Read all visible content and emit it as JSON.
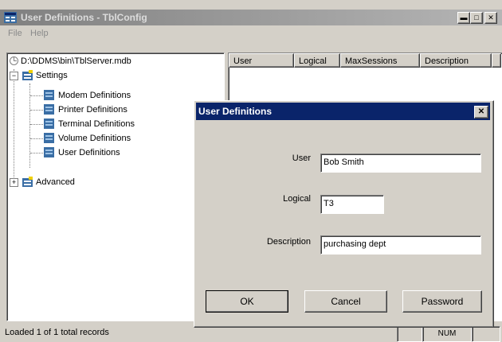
{
  "window": {
    "title": "User Definitions - TblConfig"
  },
  "menu": {
    "items": [
      "File",
      "Help"
    ]
  },
  "tree": {
    "root": "D:\\DDMS\\bin\\TblServer.mdb",
    "settings": "Settings",
    "children": [
      "Modem Definitions",
      "Printer Definitions",
      "Terminal Definitions",
      "Volume Definitions",
      "User Definitions"
    ],
    "advanced": "Advanced"
  },
  "list": {
    "columns": [
      "User",
      "Logical",
      "MaxSessions",
      "Description"
    ]
  },
  "status": {
    "text": "Loaded 1 of 1 total records",
    "num": "NUM"
  },
  "dialog": {
    "title": "User Definitions",
    "fields": [
      {
        "label": "User",
        "value": "Bob Smith"
      },
      {
        "label": "Logical",
        "value": "T3"
      },
      {
        "label": "Description",
        "value": "purchasing dept"
      }
    ],
    "buttons": {
      "ok": "OK",
      "cancel": "Cancel",
      "password": "Password"
    }
  }
}
